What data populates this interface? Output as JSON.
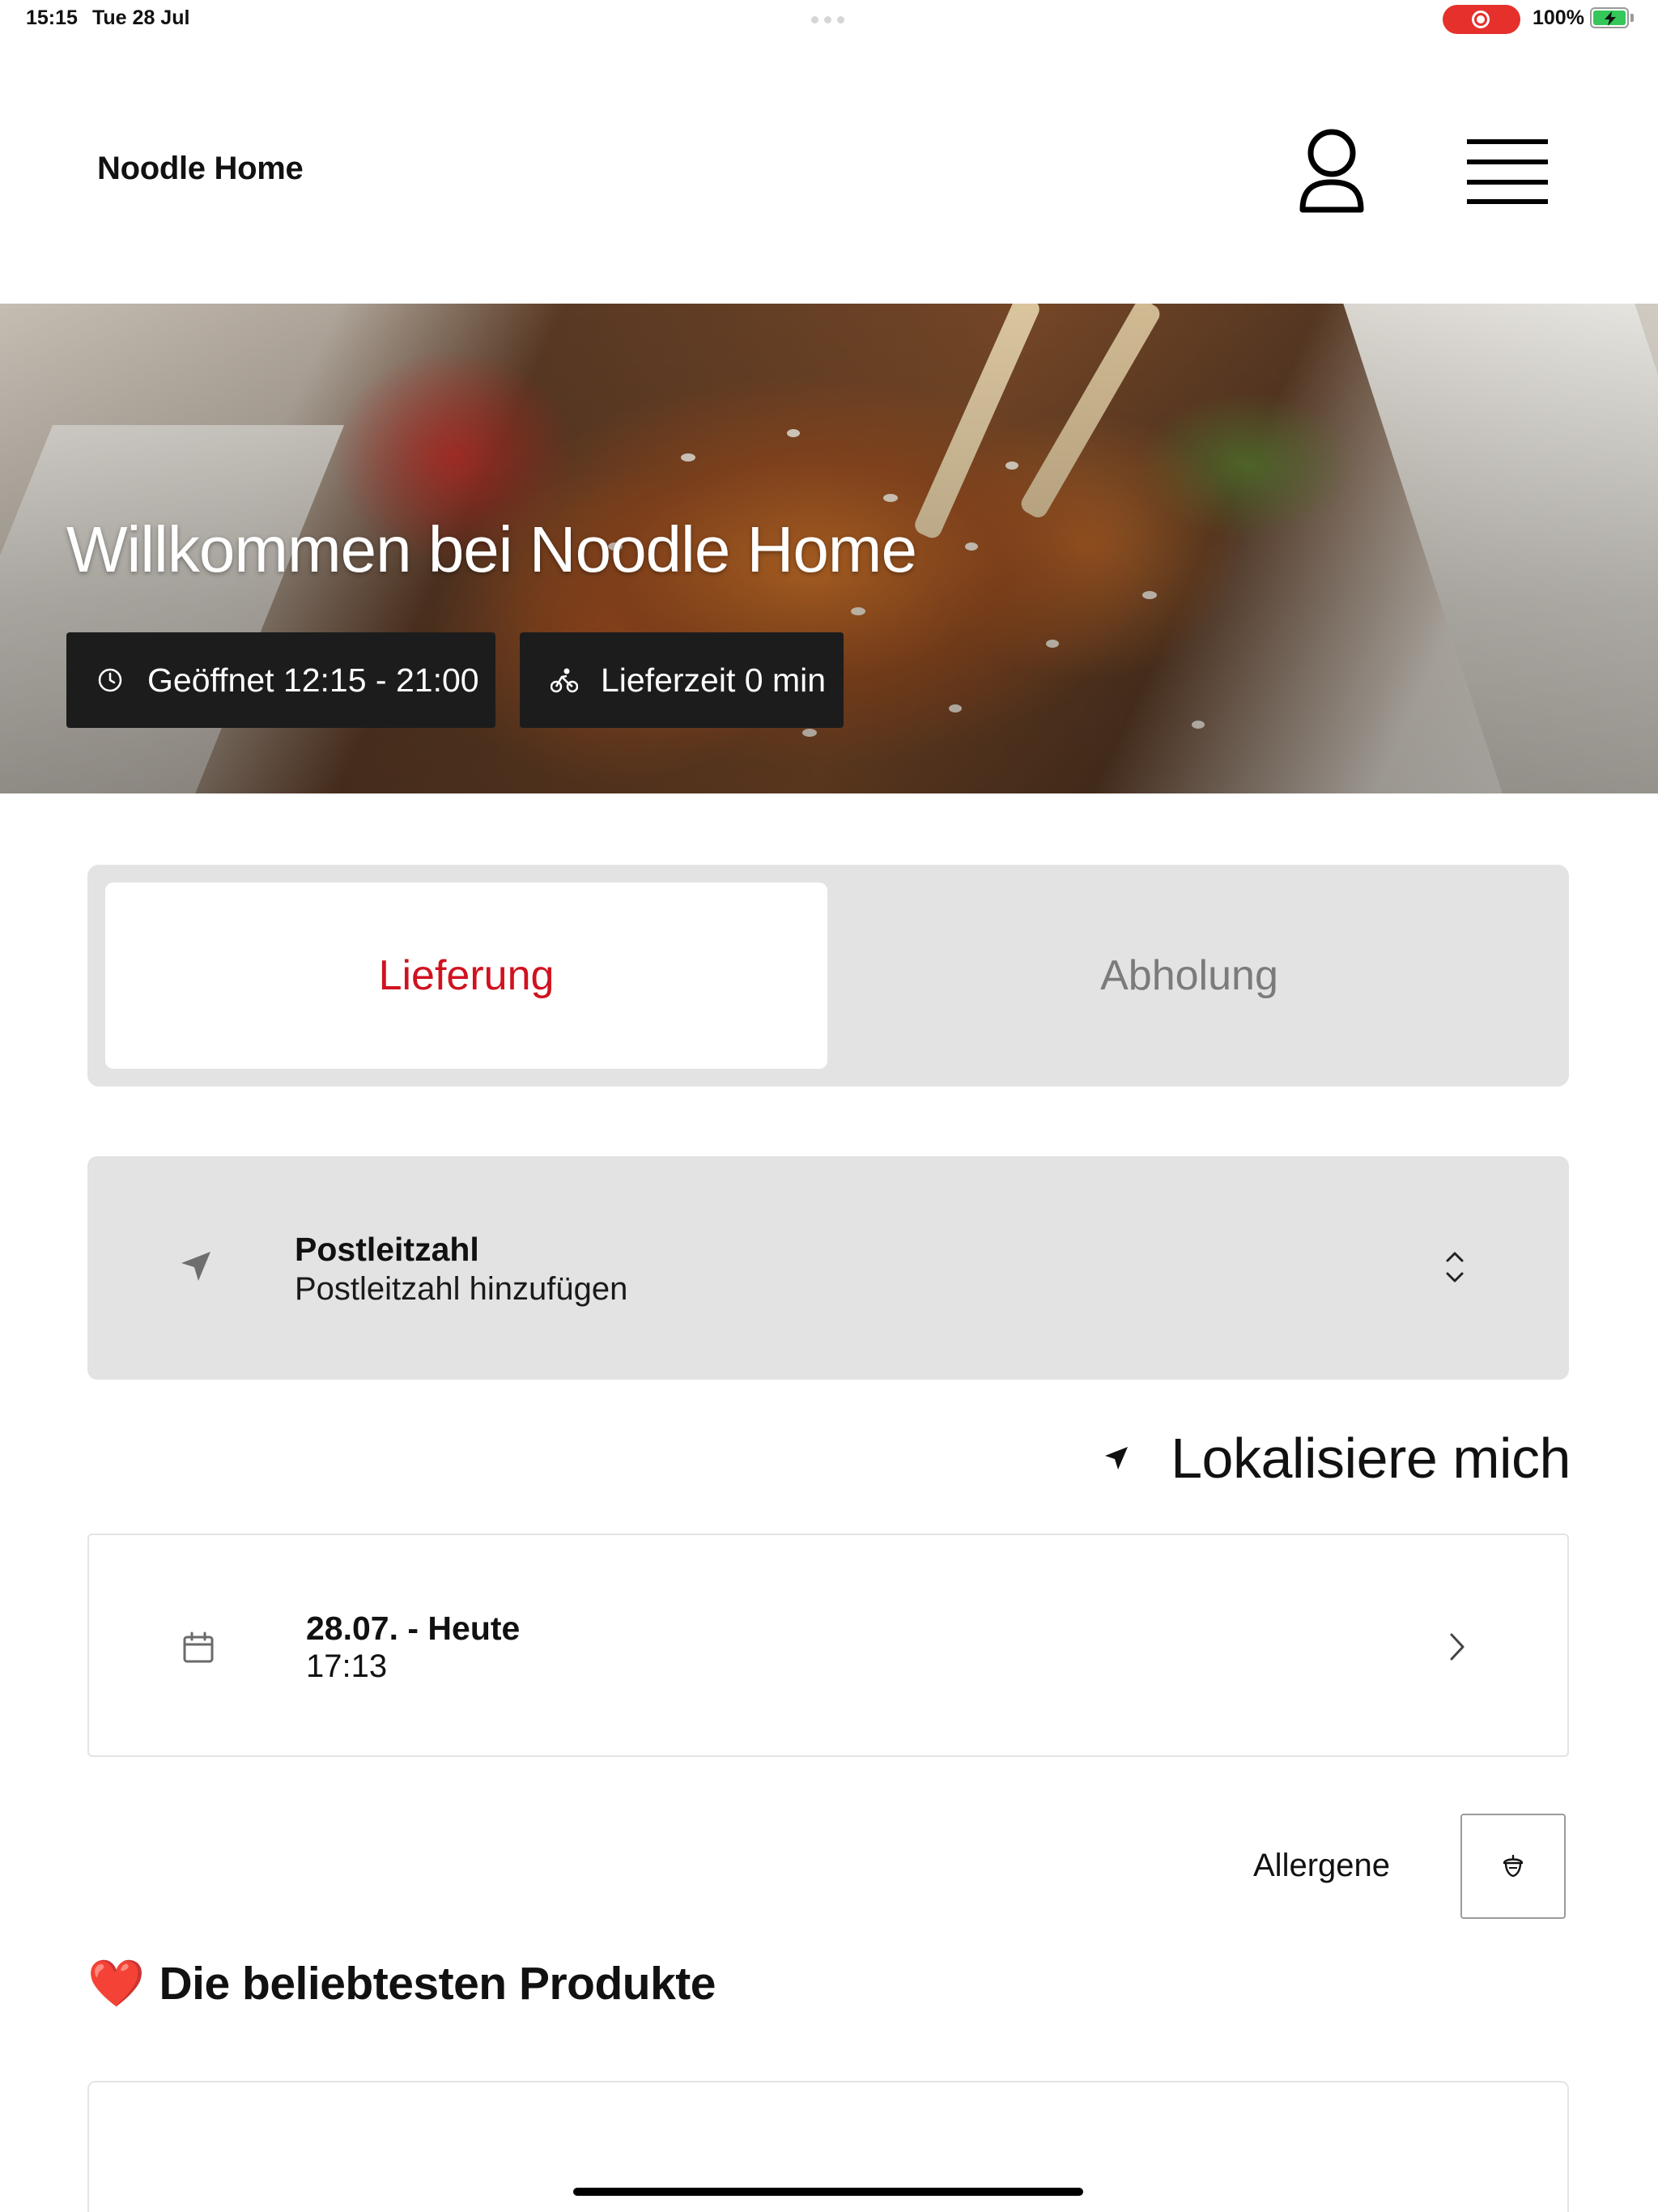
{
  "status_bar": {
    "time": "15:15",
    "date": "Tue 28 Jul",
    "battery": "100%",
    "recording_color": "#e5302b"
  },
  "header": {
    "brand": "Noodle Home",
    "profile_icon": "person-icon",
    "menu_icon": "hamburger-menu-icon"
  },
  "hero": {
    "title": "Willkommen bei Noodle Home",
    "opening_hours": "Geöffnet 12:15 - 21:00",
    "delivery_time": "Lieferzeit 0 min",
    "clock_icon": "clock-icon",
    "delivery_icon": "bicycle-icon"
  },
  "order_mode": {
    "delivery": "Lieferung",
    "pickup": "Abholung",
    "selected": "Lieferung",
    "accent_color": "#d0121f"
  },
  "postcode": {
    "label": "Postleitzahl",
    "placeholder": "Postleitzahl hinzufügen"
  },
  "locate": {
    "label": "Lokalisiere mich"
  },
  "schedule": {
    "date": "28.07. - Heute",
    "time": "17:13"
  },
  "allergens": {
    "label": "Allergene"
  },
  "popular": {
    "emoji": "❤️",
    "title": "Die beliebtesten Produkte"
  }
}
